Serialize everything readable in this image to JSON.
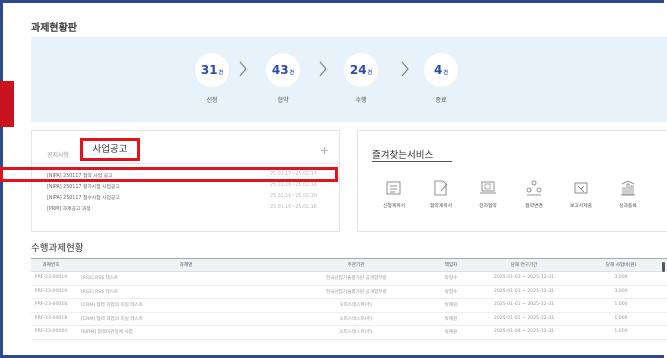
{
  "page_title": "과제현황판",
  "stats": [
    {
      "count": "31",
      "unit": "건",
      "label": "신청"
    },
    {
      "count": "43",
      "unit": "건",
      "label": "협약"
    },
    {
      "count": "24",
      "unit": "건",
      "label": "수행"
    },
    {
      "count": "4",
      "unit": "건",
      "label": "종료"
    }
  ],
  "notice": {
    "tab_inactive": "공지사항",
    "tab_active": "사업공고",
    "plus": "+",
    "rows": [
      {
        "title": "[NIPA] 250117 협약 사업 공고",
        "date": "25.01.17~25.02.17"
      },
      {
        "title": "[NIPA] 250117 평가시험 사업공고",
        "date": "25.01.16~25.02.16"
      },
      {
        "title": "[NIPA] 250117 접수시험 사업공고",
        "date": "25.01.16~25.02.16"
      },
      {
        "title": "[PRM] 과제공고 과정",
        "date": "25.01.16~25.02.16"
      }
    ]
  },
  "favorites": {
    "title": "즐겨찾는서비스",
    "items": [
      {
        "label": "신청계획서",
        "icon": "list-icon"
      },
      {
        "label": "협약계획서",
        "icon": "edit-document-icon"
      },
      {
        "label": "전자협약",
        "icon": "laptop-contract-icon"
      },
      {
        "label": "협약변경",
        "icon": "people-change-icon"
      },
      {
        "label": "보고서제출",
        "icon": "report-submit-icon"
      },
      {
        "label": "성과등록",
        "icon": "bar-chart-icon"
      }
    ]
  },
  "projects": {
    "title": "수행과제현황",
    "headers": [
      "과제번호",
      "과제명",
      "주관기관",
      "책임자",
      "당해 연구기간",
      "당해 사업비(원)"
    ],
    "rows": [
      [
        "PRF-23-00019",
        "[RSS] RSS 테스트",
        "한국산업기술평가원 공개업무방",
        "박형수",
        "2025-01-01 ~ 2025-12-31",
        "3,000"
      ],
      [
        "PRF-23-00019",
        "[RSS] RSS 테스트",
        "한국산업기술평가원 공개업무방",
        "박형수",
        "2025-01-01 ~ 2025-12-31",
        "3,000"
      ],
      [
        "PRF-23-00018",
        "[CRM] 협력 과업의 미실 테스트",
        "오피스테스트(주)",
        "박혜원",
        "2025-01-01 ~ 2025-12-31",
        "1,000"
      ],
      [
        "PRF-23-00018",
        "[CRM] 협력 과업의 미실 테스트",
        "오피스테스트(주)",
        "박혜원",
        "2025-01-01 ~ 2025-12-31",
        "1,000"
      ],
      [
        "PRF-23-00004",
        "[KIRM] 협력이관용에 사업",
        "오피스테스트(주)",
        "박혜원",
        "2025-01-04 ~ 2025-12-31",
        "1,000"
      ]
    ]
  },
  "colors": {
    "accent": "#2b4bb0",
    "highlight": "#e0141e",
    "stats_bg": "#e8f2fb",
    "frame": "#2f4a8a"
  }
}
